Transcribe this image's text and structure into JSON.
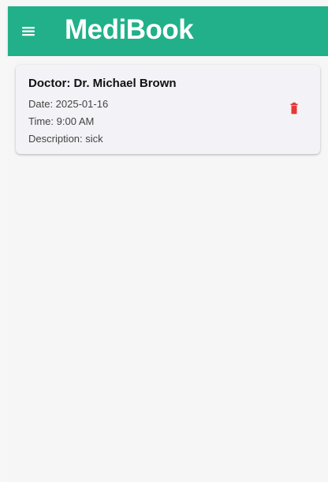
{
  "app_bar": {
    "title": "MediBook",
    "menu_icon": "hamburger-menu-icon",
    "background_color": "#21b08a",
    "title_color": "#ffffff"
  },
  "appointments": [
    {
      "doctor_label": "Doctor: Dr. Michael Brown",
      "date_label": "Date: 2025-01-16",
      "time_label": "Time: 9:00 AM",
      "description_label": "Description: sick",
      "delete_icon": "trash-icon",
      "delete_icon_color": "#e53935"
    }
  ],
  "colors": {
    "page_background": "#f6f6f6",
    "card_background": "#f3f2f6",
    "primary_text": "#111111",
    "secondary_text": "#444444"
  }
}
